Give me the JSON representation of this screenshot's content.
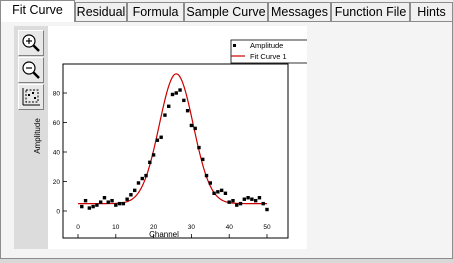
{
  "tabs": [
    {
      "label": "Fit Curve",
      "active": true
    },
    {
      "label": "Residual",
      "active": false
    },
    {
      "label": "Formula",
      "active": false
    },
    {
      "label": "Sample Curve",
      "active": false
    },
    {
      "label": "Messages",
      "active": false
    },
    {
      "label": "Function File",
      "active": false
    },
    {
      "label": "Hints",
      "active": false
    }
  ],
  "toolbar": {
    "icons": [
      "zoom-in-icon",
      "zoom-out-icon",
      "select-data-icon"
    ]
  },
  "colors": {
    "fit_curve": "#cc0000",
    "points": "#000000",
    "sidebar": "#dcdcdc"
  },
  "chart_data": {
    "type": "scatter",
    "xlabel": "Channel",
    "ylabel": "Amplitude",
    "xlim": [
      -3,
      53
    ],
    "ylim": [
      -8,
      110
    ],
    "xticks": [
      0,
      10,
      20,
      30,
      40,
      50
    ],
    "yticks": [
      0,
      20,
      40,
      60,
      80
    ],
    "legend": {
      "position": "top-right",
      "entries": [
        "Amplitude",
        "Fit Curve 1"
      ]
    },
    "series": [
      {
        "name": "Amplitude",
        "kind": "points",
        "x": [
          1,
          2,
          3,
          4,
          5,
          6,
          7,
          8,
          9,
          10,
          11,
          12,
          13,
          14,
          15,
          16,
          17,
          18,
          19,
          20,
          21,
          22,
          23,
          24,
          25,
          26,
          27,
          28,
          29,
          30,
          31,
          32,
          33,
          34,
          35,
          36,
          37,
          38,
          39,
          40,
          41,
          42,
          43,
          44,
          45,
          46,
          47,
          48,
          49,
          50
        ],
        "y": [
          3,
          7,
          2,
          3,
          4,
          6,
          9,
          6,
          7,
          4,
          5,
          5,
          8,
          11,
          14,
          19,
          22,
          24,
          33,
          38,
          48,
          50,
          65,
          71,
          79,
          80,
          82,
          75,
          68,
          58,
          56,
          43,
          35,
          24,
          19,
          12,
          13,
          14,
          12,
          6,
          7,
          4,
          5,
          8,
          9,
          8,
          7,
          9,
          5,
          1
        ]
      },
      {
        "name": "Fit Curve 1",
        "kind": "line",
        "model": "gaussian",
        "params": {
          "y0": 5,
          "xc": 26,
          "w": 9,
          "A": 88
        }
      }
    ]
  }
}
